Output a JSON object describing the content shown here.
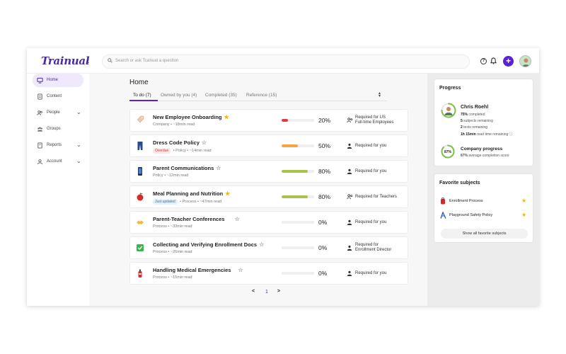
{
  "app": {
    "logo": "Trainual"
  },
  "search": {
    "placeholder": "Search or ask Trainual a question"
  },
  "topbar": {
    "plus_label": "+"
  },
  "sidebar": {
    "items": [
      {
        "label": "Home",
        "icon": "monitor-icon",
        "active": true
      },
      {
        "label": "Content",
        "icon": "document-icon"
      },
      {
        "label": "People",
        "icon": "people-icon",
        "has_chevron": true
      },
      {
        "label": "Groups",
        "icon": "groups-icon"
      },
      {
        "label": "Reports",
        "icon": "reports-icon",
        "has_chevron": true
      },
      {
        "label": "Account",
        "icon": "account-icon",
        "has_chevron": true
      }
    ]
  },
  "main": {
    "title": "Home",
    "tabs": [
      {
        "label": "To do (7)",
        "active": true
      },
      {
        "label": "Owned by you (4)"
      },
      {
        "label": "Completed (35)"
      },
      {
        "label": "Reference (15)"
      }
    ],
    "rows": [
      {
        "title": "New Employee Onboarding",
        "star": "on",
        "badge": "",
        "type": "Company",
        "read": "~18min read",
        "progress": 0.2,
        "pct": "20%",
        "color": "#e03e3e",
        "req1": "Required for US",
        "req2": "Full-time Employees",
        "req_icon": "group-icon",
        "emoji": "tag"
      },
      {
        "title": "Dress Code Policy",
        "star": "off",
        "badge": "Overdue",
        "badge_color": "red",
        "type": "Policy",
        "read": "~14min read",
        "progress": 0.5,
        "pct": "50%",
        "color": "#f5a444",
        "req1": "Required for you",
        "req2": "",
        "req_icon": "person-icon",
        "emoji": "jeans"
      },
      {
        "title": "Parent Communications",
        "star": "off",
        "badge": "",
        "type": "Policy",
        "read": "~12min read",
        "progress": 0.8,
        "pct": "80%",
        "color": "#a9c24a",
        "req1": "Required for you",
        "req2": "",
        "req_icon": "person-icon",
        "emoji": "phone"
      },
      {
        "title": "Meal Planning and Nutrition",
        "star": "on",
        "badge": "Just updated",
        "badge_color": "blue",
        "type": "Process",
        "read": "~47min read",
        "progress": 0.8,
        "pct": "80%",
        "color": "#a9c24a",
        "req1": "Required for Teachers",
        "req2": "",
        "req_icon": "group-icon",
        "emoji": "apple"
      },
      {
        "title": "Parent-Teacher Conferences",
        "star": "off",
        "badge": "",
        "type": "Process",
        "read": "~33min read",
        "progress": 0.0,
        "pct": "0%",
        "color": "#ccc",
        "req1": "Required for you",
        "req2": "",
        "req_icon": "person-icon",
        "emoji": "handshake"
      },
      {
        "title": "Collecting and Verifying Enrollment Docs",
        "star": "off",
        "badge": "",
        "type": "Process",
        "read": "~26min read",
        "progress": 0.0,
        "pct": "0%",
        "color": "#ccc",
        "req1": "Required for",
        "req2": "Enrollment Director",
        "req_icon": "person-icon",
        "emoji": "check"
      },
      {
        "title": "Handling Medical Emergencies",
        "star": "off",
        "badge": "",
        "type": "Process",
        "read": "~15min read",
        "progress": 0.0,
        "pct": "0%",
        "color": "#ccc",
        "req1": "Required for you",
        "req2": "",
        "req_icon": "person-icon",
        "emoji": "extinguisher"
      }
    ],
    "pager": {
      "prev": "<",
      "page": "1",
      "next": ">"
    }
  },
  "progress": {
    "title": "Progress",
    "name": "Chris Roehl",
    "completed_pct": "75%",
    "completed_label": "completed",
    "remaining_subjects": "5",
    "remaining_subjects_label": "subjects remaining",
    "remaining_tests": "2",
    "remaining_tests_label": "tests remaining",
    "time_remaining": "1h 15min",
    "time_remaining_label": "read time remaining",
    "user_fraction": 0.75,
    "company_pct": "87%",
    "company_fraction": 0.87,
    "company_title": "Company progress",
    "company_sub_pct": "87%",
    "company_sub": "average completion score"
  },
  "favorites": {
    "title": "Favorite subjects",
    "items": [
      {
        "label": "Enrollment Process",
        "icon": "backpack-icon"
      },
      {
        "label": "Playground Safety Policy",
        "icon": "playground-icon"
      }
    ],
    "button": "Show all favorite subjects"
  }
}
